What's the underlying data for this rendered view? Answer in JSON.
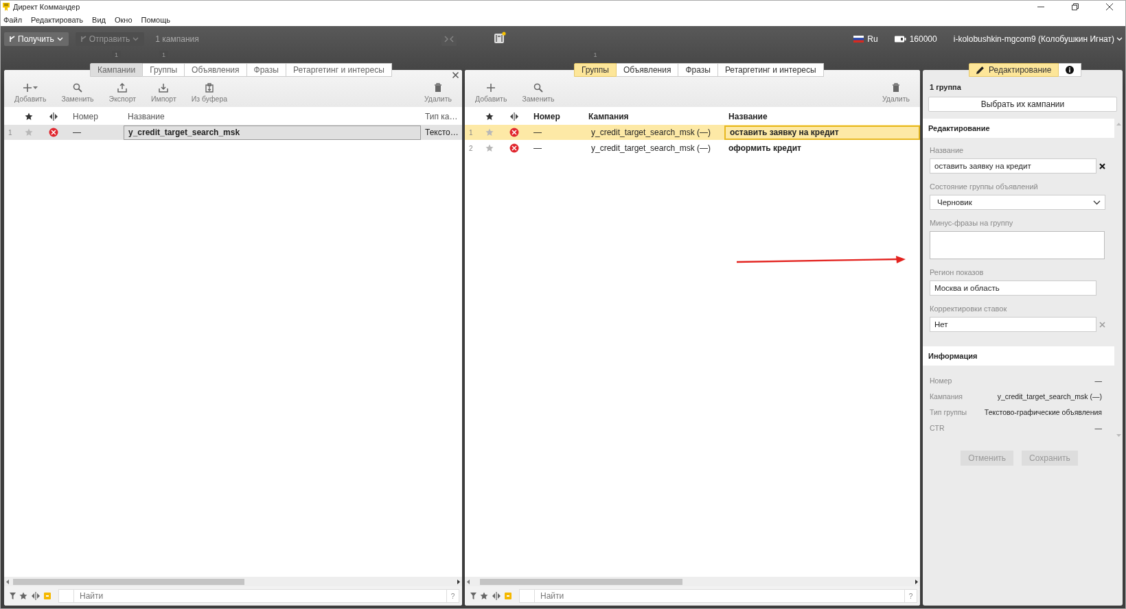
{
  "window": {
    "title": "Директ Коммандер"
  },
  "menu": [
    "Файл",
    "Редактировать",
    "Вид",
    "Окно",
    "Помощь"
  ],
  "toolbar": {
    "get_button": {
      "label": "Получить",
      "disabled": false
    },
    "send_button": {
      "label": "Отправить",
      "disabled": true
    },
    "selection": "1 кампания",
    "language": "Ru",
    "points": "160000",
    "user": "i-kolobushkin-mgcom9 (Колобушкин Игнат)"
  },
  "left_panel": {
    "tabs": [
      {
        "label": "Кампании",
        "count": "1",
        "selected": true
      },
      {
        "label": "Группы",
        "count": "1",
        "selected": false
      },
      {
        "label": "Объявления",
        "selected": false
      },
      {
        "label": "Фразы",
        "selected": false
      },
      {
        "label": "Ретаргетинг и интересы",
        "selected": false
      }
    ],
    "actions": [
      {
        "kind": "add",
        "label": "Добавить",
        "dropdown": true
      },
      {
        "kind": "replace",
        "label": "Заменить",
        "dropdown": false
      },
      {
        "kind": "export",
        "label": "Экспорт",
        "dropdown": false
      },
      {
        "kind": "import",
        "label": "Импорт",
        "dropdown": false
      },
      {
        "kind": "paste",
        "label": "Из буфера",
        "dropdown": false
      },
      {
        "kind": "delete",
        "label": "Удалить",
        "dropdown": false
      }
    ],
    "columns": [
      "Номер",
      "Название",
      "Тип ка…"
    ],
    "rows": [
      {
        "index": "1",
        "starred": false,
        "error": true,
        "number": "—",
        "name": "y_credit_target_search_msk",
        "type": "Тексто…",
        "selected": true
      }
    ],
    "search": {
      "placeholder": "Найти",
      "help": "?"
    }
  },
  "middle_panel": {
    "tabs": [
      {
        "label": "Группы",
        "count": "1",
        "selected": true
      },
      {
        "label": "Объявления",
        "selected": false
      },
      {
        "label": "Фразы",
        "selected": false
      },
      {
        "label": "Ретаргетинг и интересы",
        "selected": false
      }
    ],
    "actions": [
      {
        "kind": "add",
        "label": "Добавить",
        "dropdown": false
      },
      {
        "kind": "replace",
        "label": "Заменить",
        "dropdown": false
      },
      {
        "kind": "delete",
        "label": "Удалить",
        "dropdown": false
      }
    ],
    "columns": [
      "Номер",
      "Кампания",
      "Название"
    ],
    "rows": [
      {
        "index": "1",
        "starred": false,
        "error": true,
        "number": "—",
        "campaign": "y_credit_target_search_msk (—)",
        "name": "оставить заявку на кредит",
        "selected": true
      },
      {
        "index": "2",
        "starred": false,
        "error": true,
        "number": "—",
        "campaign": "y_credit_target_search_msk (—)",
        "name": "оформить кредит",
        "selected": false
      }
    ],
    "search": {
      "placeholder": "Найти",
      "help": "?"
    },
    "annotations": [
      {
        "kind": "arrow"
      }
    ]
  },
  "right_panel": {
    "tabs": [
      {
        "kind": "edit",
        "label": "Редактирование",
        "selected": true
      },
      {
        "kind": "info",
        "selected": false
      }
    ],
    "count": "1 группа",
    "select_campaigns_button": "Выбрать их кампании",
    "edit_section": {
      "title": "Редактирование",
      "fields": [
        {
          "kind": "text",
          "label": "Название",
          "value": "оставить заявку на кредит",
          "clearable": true,
          "clear_active": true
        },
        {
          "kind": "select",
          "label": "Состояние группы объявлений",
          "value": "Черновик"
        },
        {
          "kind": "textarea",
          "label": "Минус-фразы на группу"
        },
        {
          "kind": "text",
          "label": "Регион показов",
          "value": "Москва и область"
        },
        {
          "kind": "text",
          "label": "Корректировки ставок",
          "value": "Нет",
          "clearable": true,
          "clear_active": false
        }
      ]
    },
    "info_section": {
      "title": "Информация",
      "rows": [
        {
          "label": "Номер",
          "value": "—"
        },
        {
          "label": "Кампания",
          "value": "y_credit_target_search_msk (—)"
        },
        {
          "label": "Тип группы",
          "value": "Текстово-графические объявления"
        },
        {
          "label": "CTR",
          "value": "—"
        }
      ]
    },
    "buttons": [
      {
        "label": "Отменить",
        "disabled": true
      },
      {
        "label": "Сохранить",
        "disabled": true
      }
    ]
  }
}
